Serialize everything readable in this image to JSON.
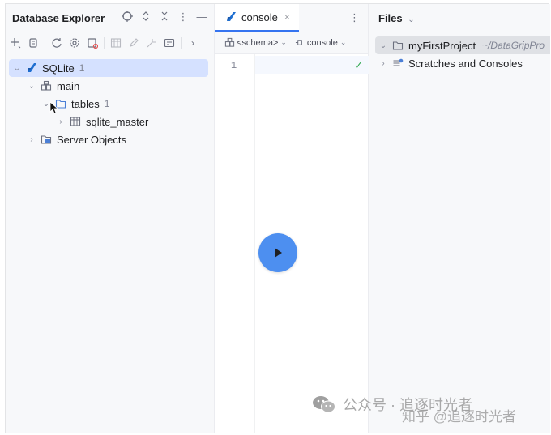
{
  "left_panel": {
    "title": "Database Explorer",
    "tree": [
      {
        "label": "SQLite",
        "count": "1"
      },
      {
        "label": "main"
      },
      {
        "label": "tables",
        "count": "1"
      },
      {
        "label": "sqlite_master"
      },
      {
        "label": "Server Objects"
      }
    ]
  },
  "editor": {
    "tab_label": "console",
    "tab_close": "×",
    "schema_selector": "<schema>",
    "console_selector": "console",
    "line_number": "1"
  },
  "files_panel": {
    "title": "Files",
    "tree": [
      {
        "label": "myFirstProject",
        "path": "~/DataGripPro"
      },
      {
        "label": "Scratches and Consoles"
      }
    ]
  },
  "watermark": {
    "text": "公众号 · 追逐时光者",
    "sub": "知乎 @追逐时光者"
  },
  "colors": {
    "accent": "#3574f0",
    "selection": "#d5e1ff",
    "play_button": "#4d8ff0",
    "check": "#2fa84f"
  }
}
